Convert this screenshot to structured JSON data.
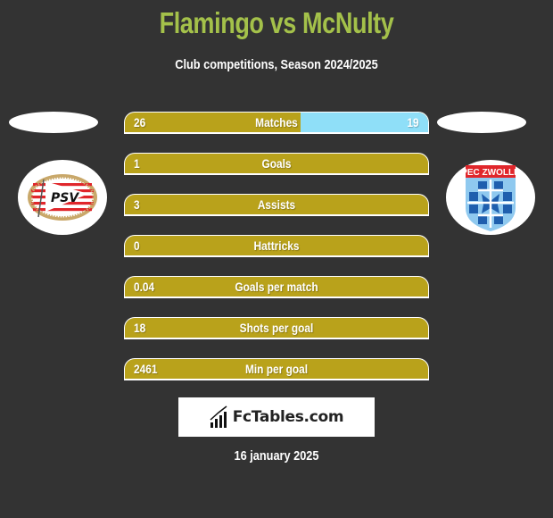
{
  "header": {
    "title": "Flamingo vs McNulty",
    "subtitle": "Club competitions, Season 2024/2025"
  },
  "players": {
    "left": {
      "name": "Flamingo",
      "club": "PSV",
      "logo_icon": "psv-logo-icon"
    },
    "right": {
      "name": "McNulty",
      "club": "PEC ZWOLLE",
      "logo_icon": "pec-zwolle-logo-icon"
    }
  },
  "colors": {
    "title": "#a4c14a",
    "left_bar": "#b9a21b",
    "right_bar": "#8fdff8",
    "background": "#333333"
  },
  "stats": [
    {
      "label": "Matches",
      "left": "26",
      "right": "19",
      "right_share": 0.42
    },
    {
      "label": "Goals",
      "left": "1",
      "right": "",
      "right_share": 0
    },
    {
      "label": "Assists",
      "left": "3",
      "right": "",
      "right_share": 0
    },
    {
      "label": "Hattricks",
      "left": "0",
      "right": "",
      "right_share": 0
    },
    {
      "label": "Goals per match",
      "left": "0.04",
      "right": "",
      "right_share": 0
    },
    {
      "label": "Shots per goal",
      "left": "18",
      "right": "",
      "right_share": 0
    },
    {
      "label": "Min per goal",
      "left": "2461",
      "right": "",
      "right_share": 0
    }
  ],
  "brand": {
    "name": "FcTables.com",
    "icon": "bar-chart-icon"
  },
  "footer": {
    "date": "16 january 2025"
  }
}
